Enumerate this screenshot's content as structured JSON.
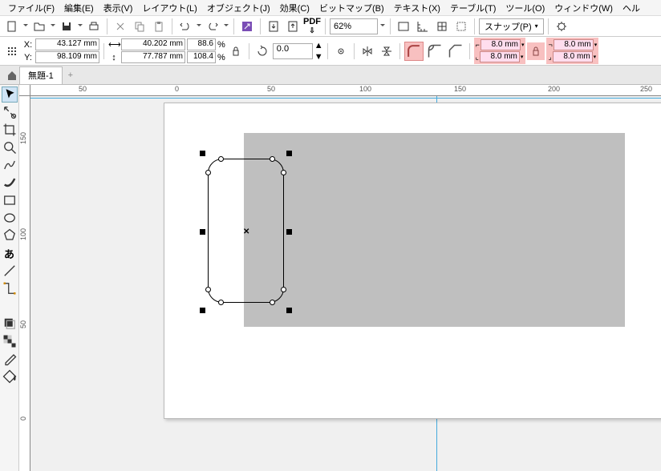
{
  "menu": {
    "file": "ファイル(F)",
    "edit": "編集(E)",
    "view": "表示(V)",
    "layout": "レイアウト(L)",
    "object": "オブジェクト(J)",
    "effect": "効果(C)",
    "bitmap": "ビットマップ(B)",
    "text": "テキスト(X)",
    "table": "テーブル(T)",
    "tool": "ツール(O)",
    "window": "ウィンドウ(W)",
    "help": "ヘル"
  },
  "toolbar": {
    "zoom": "62%",
    "snap": "スナップ(P)"
  },
  "prop": {
    "x": "43.127 mm",
    "y": "98.109 mm",
    "w": "40.202 mm",
    "h": "77.787 mm",
    "sx": "88.6",
    "sy": "108.4",
    "rot": "0.0",
    "c1": "8.0 mm",
    "c2": "8.0 mm",
    "c3": "8.0 mm",
    "c4": "8.0 mm",
    "xlbl": "X:",
    "ylbl": "Y:",
    "pct": "%"
  },
  "tab": {
    "title": "無題-1",
    "add": "+"
  },
  "ruler": {
    "h": [
      "50",
      "0",
      "50",
      "100",
      "150",
      "200",
      "250"
    ],
    "v": [
      "150",
      "100",
      "50",
      "0"
    ]
  },
  "glyph": {
    "pdf": "PDF",
    "text": "あ"
  }
}
